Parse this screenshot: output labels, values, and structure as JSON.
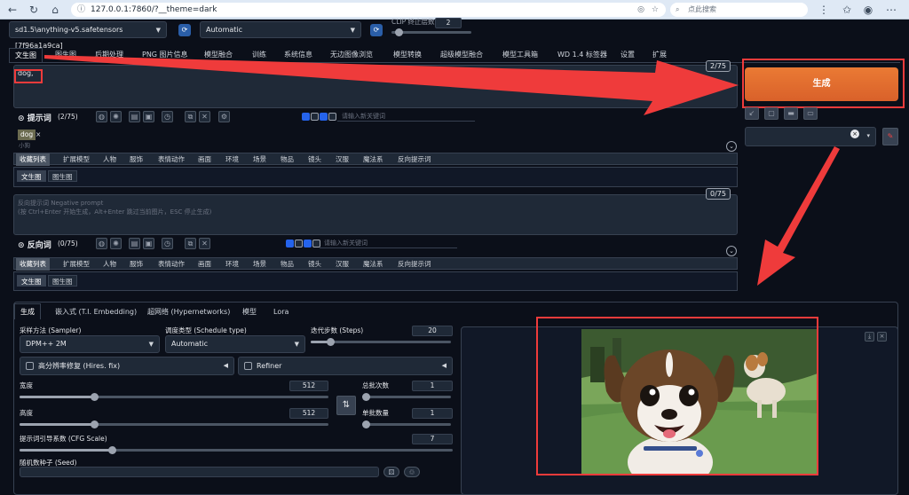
{
  "browser": {
    "url": "127.0.0.1:7860/?__theme=dark",
    "search_placeholder": "点此搜索"
  },
  "top_controls": {
    "checkpoint": "sd1.5\\anything-v5.safetensors [7f96a1a9ca]",
    "vae": "Automatic",
    "clip_label": "CLIP 终止层数",
    "clip_value": "2"
  },
  "main_tabs": [
    "文生图",
    "图生图",
    "后期处理",
    "PNG 图片信息",
    "模型融合",
    "训练",
    "系统信息",
    "无边图像浏览",
    "模型转换",
    "超级模型融合",
    "模型工具箱",
    "WD 1.4 标签器",
    "设置",
    "扩展"
  ],
  "prompt": {
    "text": "dog,",
    "counter": "2/75",
    "label": "提示词",
    "label_count": "(2/75)",
    "keyword_placeholder": "请输入新关键词",
    "tag": "dog",
    "tag_sub": "小狗"
  },
  "categories": [
    "收藏列表",
    "扩展模型",
    "人物",
    "服饰",
    "表情动作",
    "画面",
    "环境",
    "场景",
    "物品",
    "镜头",
    "汉服",
    "魔法系",
    "反向提示词"
  ],
  "subtabs": [
    "文生图",
    "图生图"
  ],
  "negative": {
    "placeholder_line1": "反向提示词 Negative prompt",
    "placeholder_line2": "(按 Ctrl+Enter 开始生成，Alt+Enter 跳过当前图片，ESC 停止生成)",
    "counter": "0/75",
    "label": "反向词",
    "label_count": "(0/75)",
    "keyword_placeholder": "请输入新关键词"
  },
  "generate_button": "生成",
  "settings_tabs": [
    "生成",
    "嵌入式 (T.I. Embedding)",
    "超网络 (Hypernetworks)",
    "模型",
    "Lora"
  ],
  "settings": {
    "sampler_label": "采样方法 (Sampler)",
    "sampler_value": "DPM++ 2M",
    "schedule_label": "调度类型 (Schedule type)",
    "schedule_value": "Automatic",
    "steps_label": "迭代步数 (Steps)",
    "steps_value": "20",
    "hires_label": "高分辨率修复 (Hires. fix)",
    "refiner_label": "Refiner",
    "width_label": "宽度",
    "width_value": "512",
    "height_label": "高度",
    "height_value": "512",
    "batch_count_label": "总批次数",
    "batch_count_value": "1",
    "batch_size_label": "单批数量",
    "batch_size_value": "1",
    "cfg_label": "提示词引导系数 (CFG Scale)",
    "cfg_value": "7",
    "seed_label": "随机数种子 (Seed)"
  },
  "colors": {
    "accent": "#ea7a34",
    "annotation": "#ef3b3b",
    "checkbox": "#2563eb"
  }
}
